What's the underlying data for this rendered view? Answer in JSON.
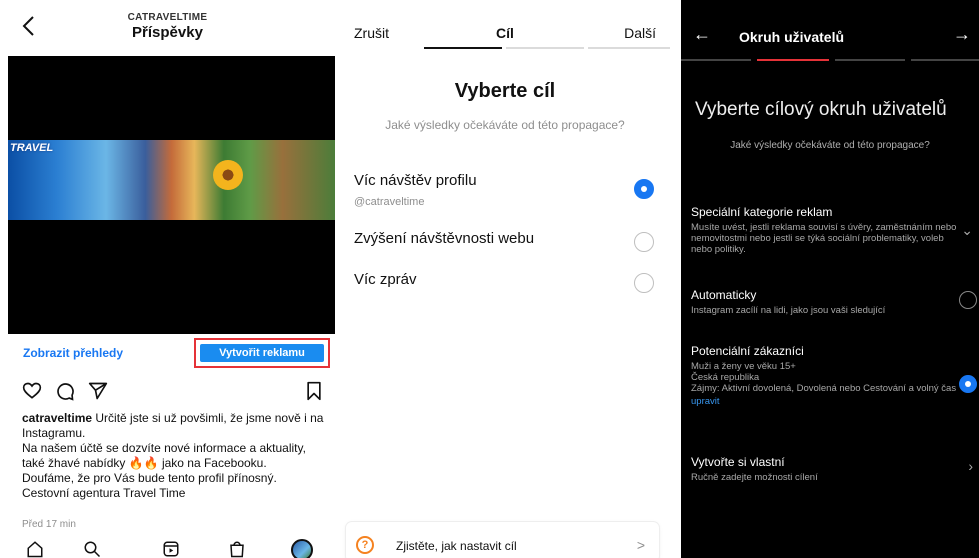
{
  "panel1": {
    "account": "CATRAVELTIME",
    "title": "Příspěvky",
    "banner_logo": "TRAVEL",
    "insights_link": "Zobrazit přehledy",
    "create_ad_button": "Vytvořit reklamu",
    "caption_user": "catraveltime",
    "caption_text": " Určitě jste si už povšimli, že jsme nově i na Instagramu.",
    "caption_line2": "Na našem účtě se dozvíte nové informace a aktuality, také žhavé nabídky 🔥🔥 jako na Facebooku.",
    "caption_line3": "Doufáme, že pro Vás bude tento profil přínosný.",
    "caption_line4": "Cestovní agentura Travel Time",
    "time_ago": "Před 17 min",
    "icons": [
      "back-chevron-icon",
      "heart-icon",
      "comment-icon",
      "send-icon",
      "bookmark-icon",
      "home-icon",
      "search-icon",
      "reels-icon",
      "shop-icon",
      "profile-avatar"
    ]
  },
  "panel2": {
    "cancel": "Zrušit",
    "step": "Cíl",
    "next": "Další",
    "heading": "Vyberte cíl",
    "subheading": "Jaké výsledky očekáváte od této propagace?",
    "options": [
      {
        "label": "Víc návštěv profilu",
        "sub": "@catraveltime",
        "selected": true
      },
      {
        "label": "Zvýšení návštěvnosti webu",
        "sub": "",
        "selected": false
      },
      {
        "label": "Víc zpráv",
        "sub": "",
        "selected": false
      }
    ],
    "help_text": "Zjistěte, jak nastavit cíl",
    "accent": "#1877f2"
  },
  "panel3": {
    "back": "←",
    "title": "Okruh uživatelů",
    "next": "→",
    "heading": "Vyberte cílový okruh uživatelů",
    "subheading": "Jaké výsledky očekáváte od této propagace?",
    "special_title": "Speciální kategorie reklam",
    "special_desc": "Musíte uvést, jestli reklama souvisí s úvěry, zaměstnáním nebo nemovitostmi nebo jestli se týká sociální problematiky, voleb nebo politiky.",
    "auto_title": "Automaticky",
    "auto_desc": "Instagram zacílí na lidi, jako jsou vaši sledující",
    "potential_title": "Potenciální zákazníci",
    "potential_line1": "Muži a ženy ve věku 15+",
    "potential_line2": "Česká republika",
    "potential_line3": "Zájmy: Aktivní dovolená, Dovolená nebo Cestování a volný čas",
    "potential_edit": "upravit",
    "custom_title": "Vytvořte si vlastní",
    "custom_desc": "Ručně zadejte možnosti cílení"
  }
}
